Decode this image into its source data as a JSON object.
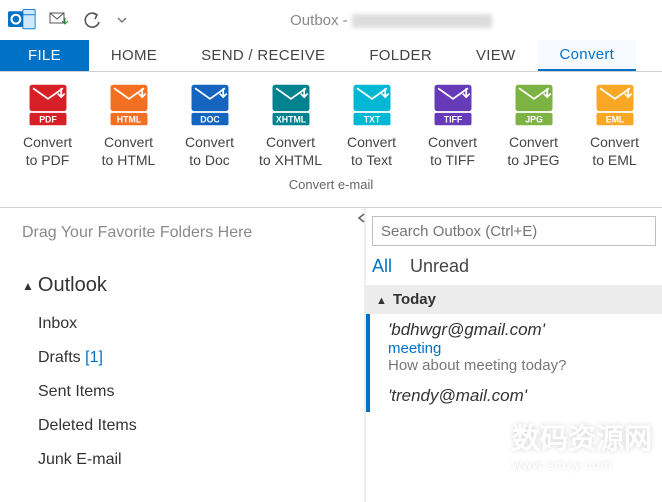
{
  "titlebar": {
    "title_prefix": "Outbox - "
  },
  "tabs": {
    "file": "FILE",
    "home": "HOME",
    "sendreceive": "SEND / RECEIVE",
    "folder": "FOLDER",
    "view": "VIEW",
    "convert": "Convert"
  },
  "ribbon": {
    "buttons": [
      {
        "line1": "Convert",
        "line2": "to PDF",
        "badge": "PDF",
        "color": "#d61f26"
      },
      {
        "line1": "Convert",
        "line2": "to HTML",
        "badge": "HTML",
        "color": "#f36f21"
      },
      {
        "line1": "Convert",
        "line2": "to Doc",
        "badge": "DOC",
        "color": "#1565c0"
      },
      {
        "line1": "Convert",
        "line2": "to XHTML",
        "badge": "XHTML",
        "color": "#00838f"
      },
      {
        "line1": "Convert",
        "line2": "to Text",
        "badge": "TXT",
        "color": "#00b8d4"
      },
      {
        "line1": "Convert",
        "line2": "to TIFF",
        "badge": "TIFF",
        "color": "#673ab7"
      },
      {
        "line1": "Convert",
        "line2": "to JPEG",
        "badge": "JPG",
        "color": "#7cb342"
      },
      {
        "line1": "Convert",
        "line2": "to EML",
        "badge": "EML",
        "color": "#f9a825"
      }
    ],
    "group_caption": "Convert e-mail"
  },
  "nav": {
    "favorites_hint": "Drag Your Favorite Folders Here",
    "root": "Outlook",
    "items": [
      {
        "label": "Inbox"
      },
      {
        "label": "Drafts",
        "count": "[1]"
      },
      {
        "label": "Sent Items"
      },
      {
        "label": "Deleted Items"
      },
      {
        "label": "Junk E-mail"
      }
    ]
  },
  "list": {
    "search_placeholder": "Search Outbox (Ctrl+E)",
    "filters": {
      "all": "All",
      "unread": "Unread"
    },
    "group": "Today",
    "messages": [
      {
        "from": "'bdhwgr@gmail.com'",
        "subject": "meeting",
        "preview": "How about meeting today?"
      },
      {
        "from": "'trendy@mail.com'"
      }
    ]
  },
  "watermark": {
    "line1": "数码资源网",
    "line2": "www.smzy.com"
  }
}
